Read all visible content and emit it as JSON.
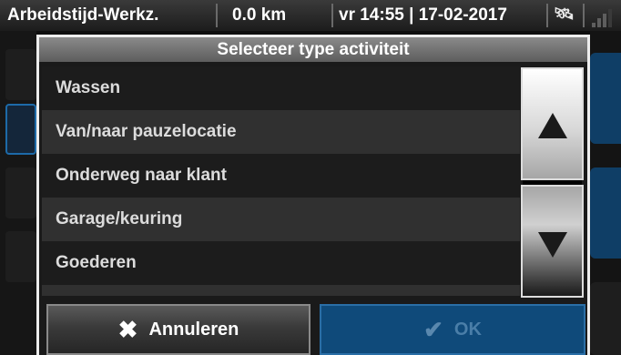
{
  "status_bar": {
    "title": "Arbeidstijd-Werkz.",
    "distance": "0.0 km",
    "datetime": "vr 14:55 | 17-02-2017",
    "satellite_icon": "satellite-icon",
    "signal_icon": "signal-strength-icon"
  },
  "dialog": {
    "title": "Selecteer type activiteit",
    "items": [
      {
        "label": "Wassen"
      },
      {
        "label": "Van/naar pauzelocatie"
      },
      {
        "label": "Onderweg naar klant"
      },
      {
        "label": "Garage/keuring"
      },
      {
        "label": "Goederen"
      }
    ],
    "scroll_up_icon": "triangle-up-icon",
    "scroll_down_icon": "triangle-down-icon",
    "cancel_label": "Annuleren",
    "cancel_icon": "x-mark-icon",
    "ok_label": "OK",
    "ok_icon": "checkmark-icon"
  },
  "colors": {
    "accent_blue": "#0f4a7a",
    "title_bar_gray": "#6e6e6e"
  }
}
